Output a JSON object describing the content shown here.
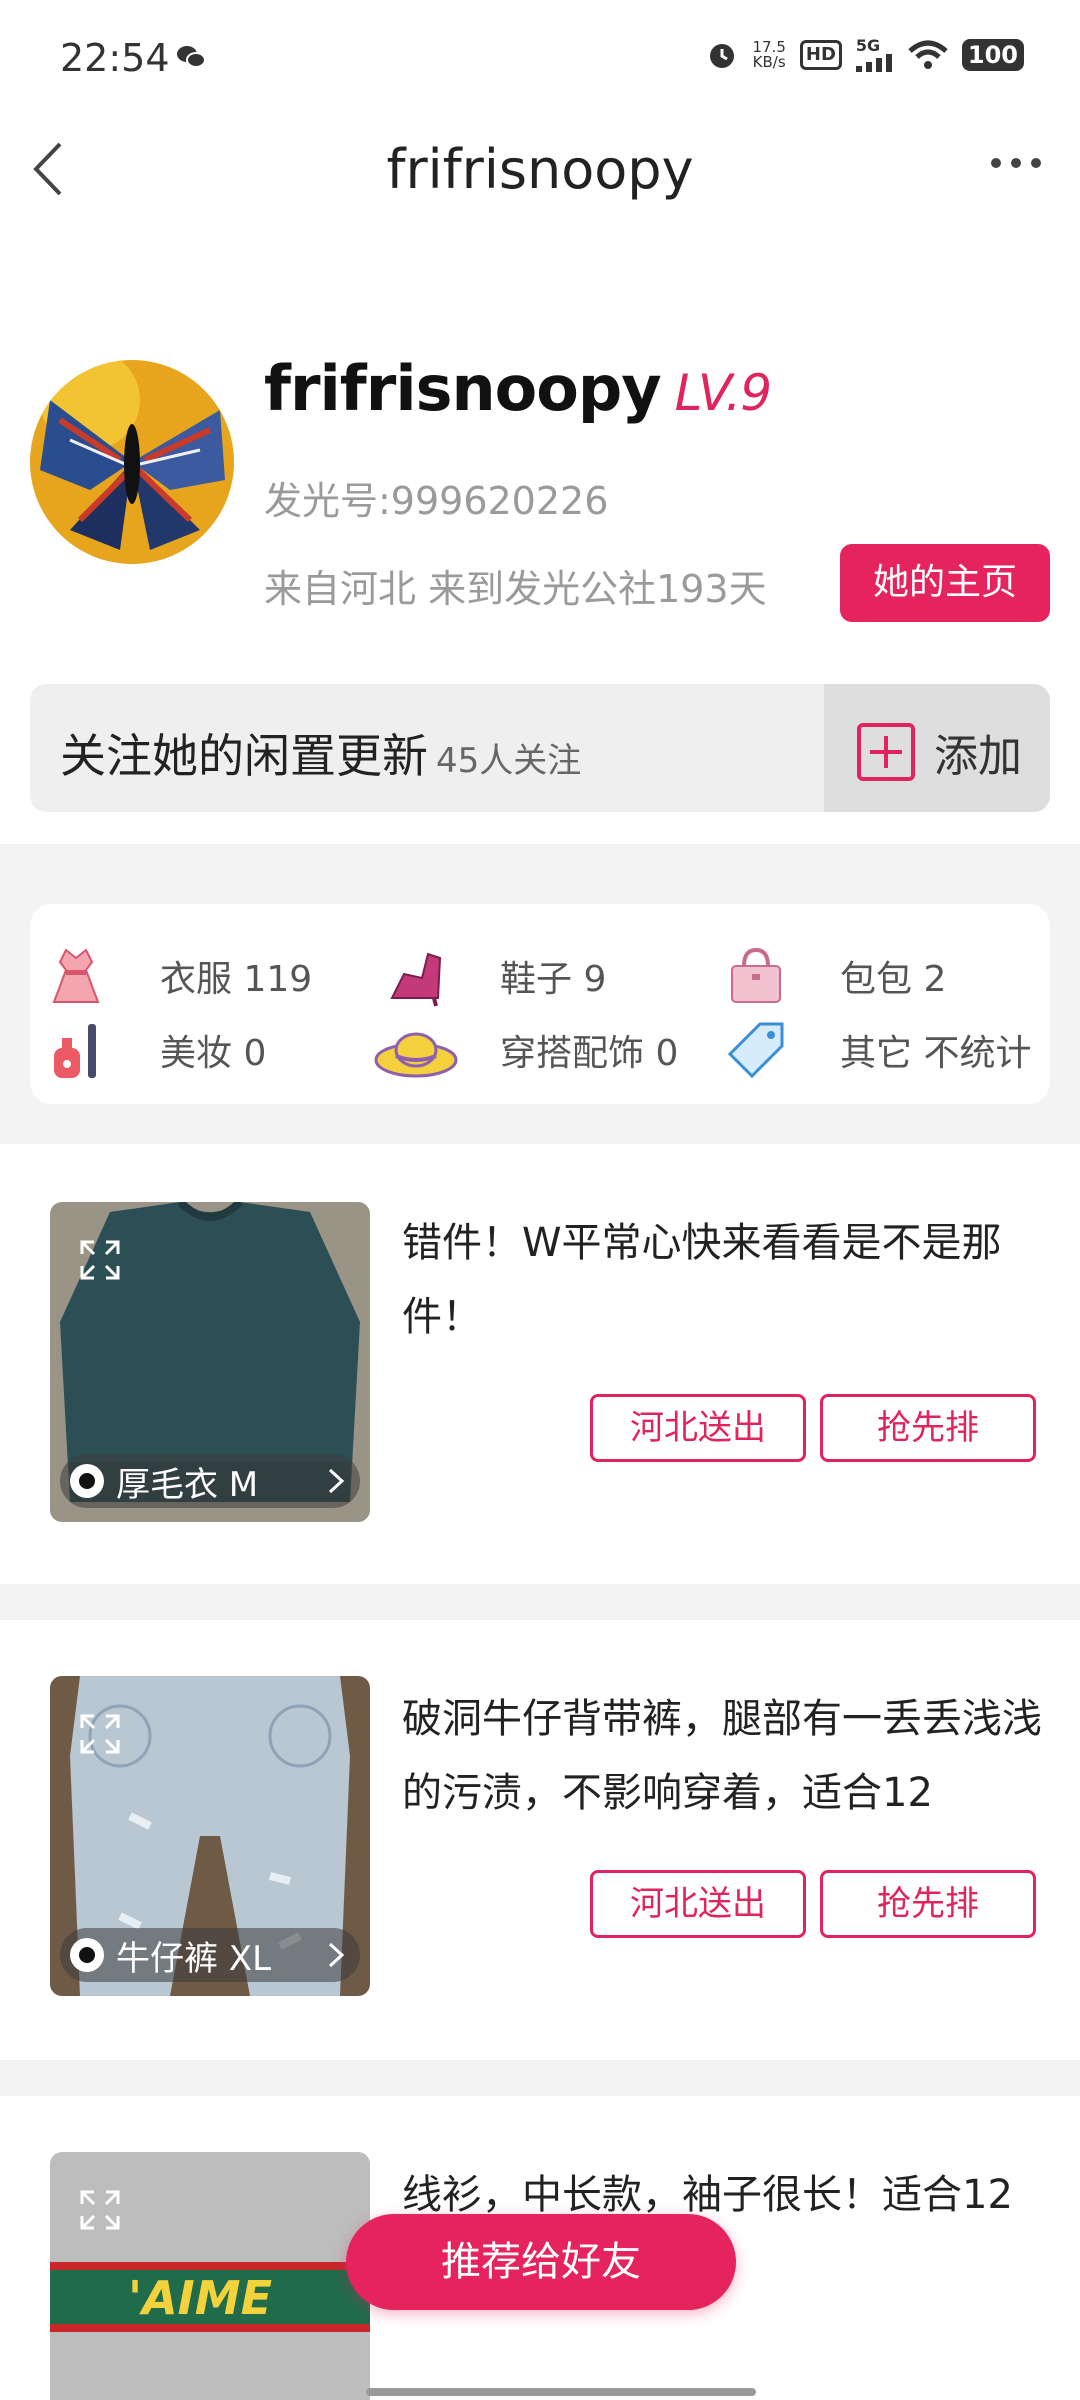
{
  "status_bar": {
    "time": "22:54",
    "net_speed_value": "17.5",
    "net_speed_unit": "KB/s",
    "hd": "HD",
    "signal": "5G",
    "battery": "100"
  },
  "nav": {
    "title": "frifrisnoopy"
  },
  "profile": {
    "name": "frifrisnoopy",
    "level": "LV.9",
    "id_text": "发光号:999620226",
    "from_text": "来自河北 来到发光公社193天",
    "home_button": "她的主页"
  },
  "follow": {
    "text": "关注她的闲置更新",
    "count": "45人关注",
    "add_label": "添加"
  },
  "stats": [
    {
      "label": "衣服 119",
      "icon": "dress-icon"
    },
    {
      "label": "鞋子 9",
      "icon": "high-heel-icon"
    },
    {
      "label": "包包 2",
      "icon": "handbag-icon"
    },
    {
      "label": "美妆 0",
      "icon": "makeup-icon"
    },
    {
      "label": "穿搭配饰 0",
      "icon": "sun-hat-icon"
    },
    {
      "label": "其它 不统计",
      "icon": "price-tag-icon"
    }
  ],
  "items": [
    {
      "tag": "厚毛衣 M",
      "desc": "错件！W平常心快来看看是不是那件！",
      "btn_send": "河北送出",
      "btn_queue": "抢先排"
    },
    {
      "tag": "牛仔裤 XL",
      "desc": "破洞牛仔背带裤，腿部有一丢丢浅浅的污渍，不影响穿着，适合12",
      "btn_send": "河北送出",
      "btn_queue": "抢先排"
    },
    {
      "tag": "",
      "desc": "线衫，中长款，袖子很长！适合12 款式",
      "btn_send": "",
      "btn_queue": ""
    }
  ],
  "item3_print": "'AIME",
  "float_button": "推荐给好友",
  "colors": {
    "accent": "#e5235d",
    "background": "#f3f3f3"
  }
}
